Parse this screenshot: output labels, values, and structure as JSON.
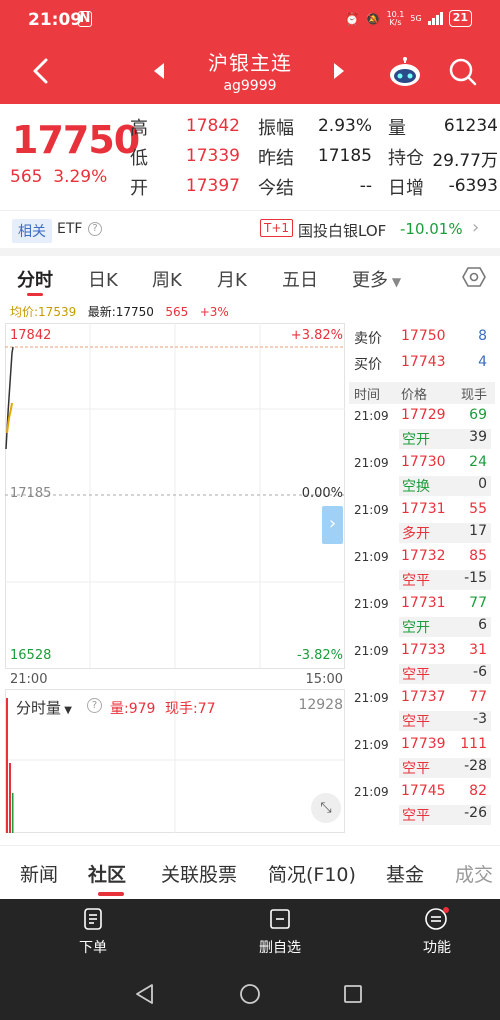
{
  "status": {
    "time": "21:09",
    "nfc": "N",
    "net_speed_top": "10.1",
    "net_speed_unit": "K/s",
    "net_type": "5G",
    "battery": "21"
  },
  "header": {
    "title": "沪银主连",
    "subtitle": "ag9999"
  },
  "quote": {
    "price": "17750",
    "change": "565",
    "change_pct": "3.29%",
    "high_label": "高",
    "high": "17842",
    "low_label": "低",
    "low": "17339",
    "open_label": "开",
    "open": "17397",
    "amp_label": "振幅",
    "amp": "2.93%",
    "prev_settle_label": "昨结",
    "prev_settle": "17185",
    "settle_label": "今结",
    "settle": "--",
    "vol_label": "量",
    "vol": "61234",
    "oi_label": "持仓",
    "oi": "29.77万",
    "daily_inc_label": "日增",
    "daily_inc": "-6393"
  },
  "related": {
    "tag": "相关",
    "etf": "ETF",
    "t1": "T+1",
    "lof_name": "国投白银LOF",
    "lof_pct": "-10.01%"
  },
  "period_tabs": [
    "分时",
    "日K",
    "周K",
    "月K",
    "五日",
    "更多"
  ],
  "avg_line": {
    "avg_label": "均价:",
    "avg": "17539",
    "latest_label": "最新:",
    "latest": "17750",
    "chg": "565",
    "pct": "+3%"
  },
  "chart": {
    "top_price": "17842",
    "top_pct": "+3.82%",
    "mid_price": "17185",
    "mid_pct": "0.00%",
    "bot_price": "16528",
    "bot_pct": "-3.82%",
    "start_time": "21:00",
    "end_time": "15:00",
    "vol_selector": "分时量",
    "vol_label": "量:979",
    "hand_label": "现手:77",
    "vol_max": "12928"
  },
  "book": {
    "ask_label": "卖价",
    "ask_price": "17750",
    "ask_vol": "8",
    "bid_label": "买价",
    "bid_price": "17743",
    "bid_vol": "4",
    "hdr_time": "时间",
    "hdr_price": "价格",
    "hdr_hand": "现手",
    "ticks": [
      {
        "time": "21:09",
        "price": "17729",
        "vol": "69",
        "type": "空开",
        "chg": "39"
      },
      {
        "time": "21:09",
        "price": "17730",
        "vol": "24",
        "type": "空换",
        "chg": "0"
      },
      {
        "time": "21:09",
        "price": "17731",
        "vol": "55",
        "type": "多开",
        "chg": "17"
      },
      {
        "time": "21:09",
        "price": "17732",
        "vol": "85",
        "type": "空平",
        "chg": "-15"
      },
      {
        "time": "21:09",
        "price": "17731",
        "vol": "77",
        "type": "空开",
        "chg": "6"
      },
      {
        "time": "21:09",
        "price": "17733",
        "vol": "31",
        "type": "空平",
        "chg": "-6"
      },
      {
        "time": "21:09",
        "price": "17737",
        "vol": "77",
        "type": "空平",
        "chg": "-3"
      },
      {
        "time": "21:09",
        "price": "17739",
        "vol": "111",
        "type": "空平",
        "chg": "-28"
      },
      {
        "time": "21:09",
        "price": "17745",
        "vol": "82",
        "type": "空平",
        "chg": "-26"
      }
    ]
  },
  "bottom_tabs": [
    "新闻",
    "社区",
    "关联股票",
    "简况(F10)",
    "基金",
    "成交"
  ],
  "actions": {
    "order": "下单",
    "remove_fav": "删自选",
    "features": "功能"
  }
}
